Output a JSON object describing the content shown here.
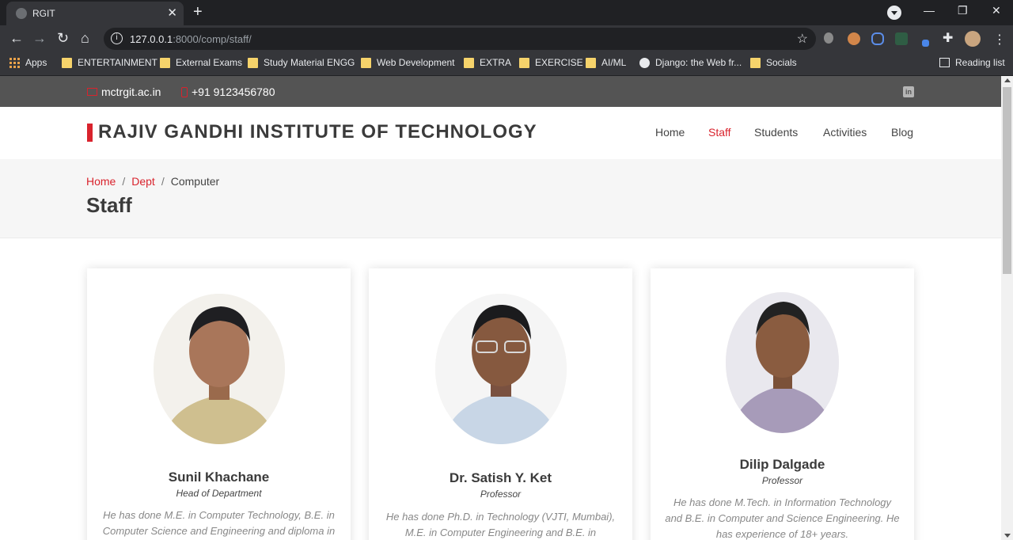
{
  "browser": {
    "tab_title": "RGIT",
    "url_host": "127.0.0.1",
    "url_path": ":8000/comp/staff/",
    "bookmarks": [
      "Apps",
      "ENTERTAINMENT",
      "External Exams",
      "Study Material ENGG",
      "Web Development",
      "EXTRA",
      "EXERCISE",
      "AI/ML",
      "Django: the Web fr...",
      "Socials"
    ],
    "reading_list": "Reading list"
  },
  "topbar": {
    "email": "mctrgit.ac.in",
    "phone": "+91 9123456780"
  },
  "header": {
    "logo": "RAJIV GANDHI INSTITUTE OF TECHNOLOGY",
    "nav": [
      "Home",
      "Staff",
      "Students",
      "Activities",
      "Blog"
    ],
    "active_nav": "Staff"
  },
  "breadcrumbs": {
    "items": [
      "Home",
      "Dept",
      "Computer"
    ],
    "title": "Staff"
  },
  "staff": [
    {
      "name": "Sunil Khachane",
      "role": "Head of Department",
      "bio_line1": "He has done M.E. in Computer Technology, B.E. in",
      "bio_line2": "Computer Science and Engineering and diploma in"
    },
    {
      "name": "Dr. Satish Y. Ket",
      "role": "Professor",
      "bio_line1": "He has done Ph.D. in Technology (VJTI, Mumbai),",
      "bio_line2": "M.E. in Computer Engineering and B.E. in"
    },
    {
      "name": "Dilip Dalgade",
      "role": "Professor",
      "bio_line1": "He has done M.Tech. in Information Technology",
      "bio_line2": "and B.E. in Computer and Science Engineering. He",
      "bio_line3": "has experience of 18+ years."
    }
  ],
  "colors": {
    "accent": "#d9232d",
    "topbar": "#545454",
    "text": "#3b3b3b"
  }
}
